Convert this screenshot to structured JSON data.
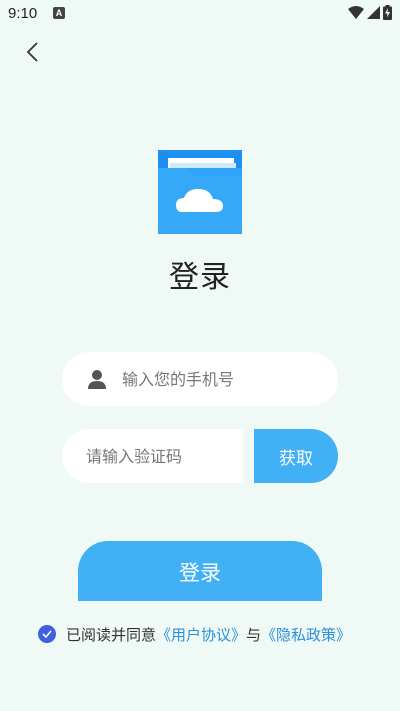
{
  "status_bar": {
    "time": "9:10",
    "notification_badge": "A"
  },
  "page": {
    "title": "登录"
  },
  "form": {
    "phone_placeholder": "输入您的手机号",
    "code_placeholder": "请输入验证码",
    "get_code_label": "获取",
    "login_label": "登录"
  },
  "agreement": {
    "prefix": "已阅读并同意",
    "user_agreement": "《用户协议》",
    "conjunction": "与",
    "privacy_policy": "《隐私政策》",
    "checked": true
  },
  "colors": {
    "background": "#effaf6",
    "primary": "#41b0f5",
    "link": "#2a8fdc",
    "checkbox": "#3f5fe0"
  },
  "icons": [
    "back-arrow-icon",
    "folder-cloud-logo",
    "person-icon",
    "check-icon",
    "wifi-icon",
    "signal-icon",
    "battery-icon"
  ]
}
